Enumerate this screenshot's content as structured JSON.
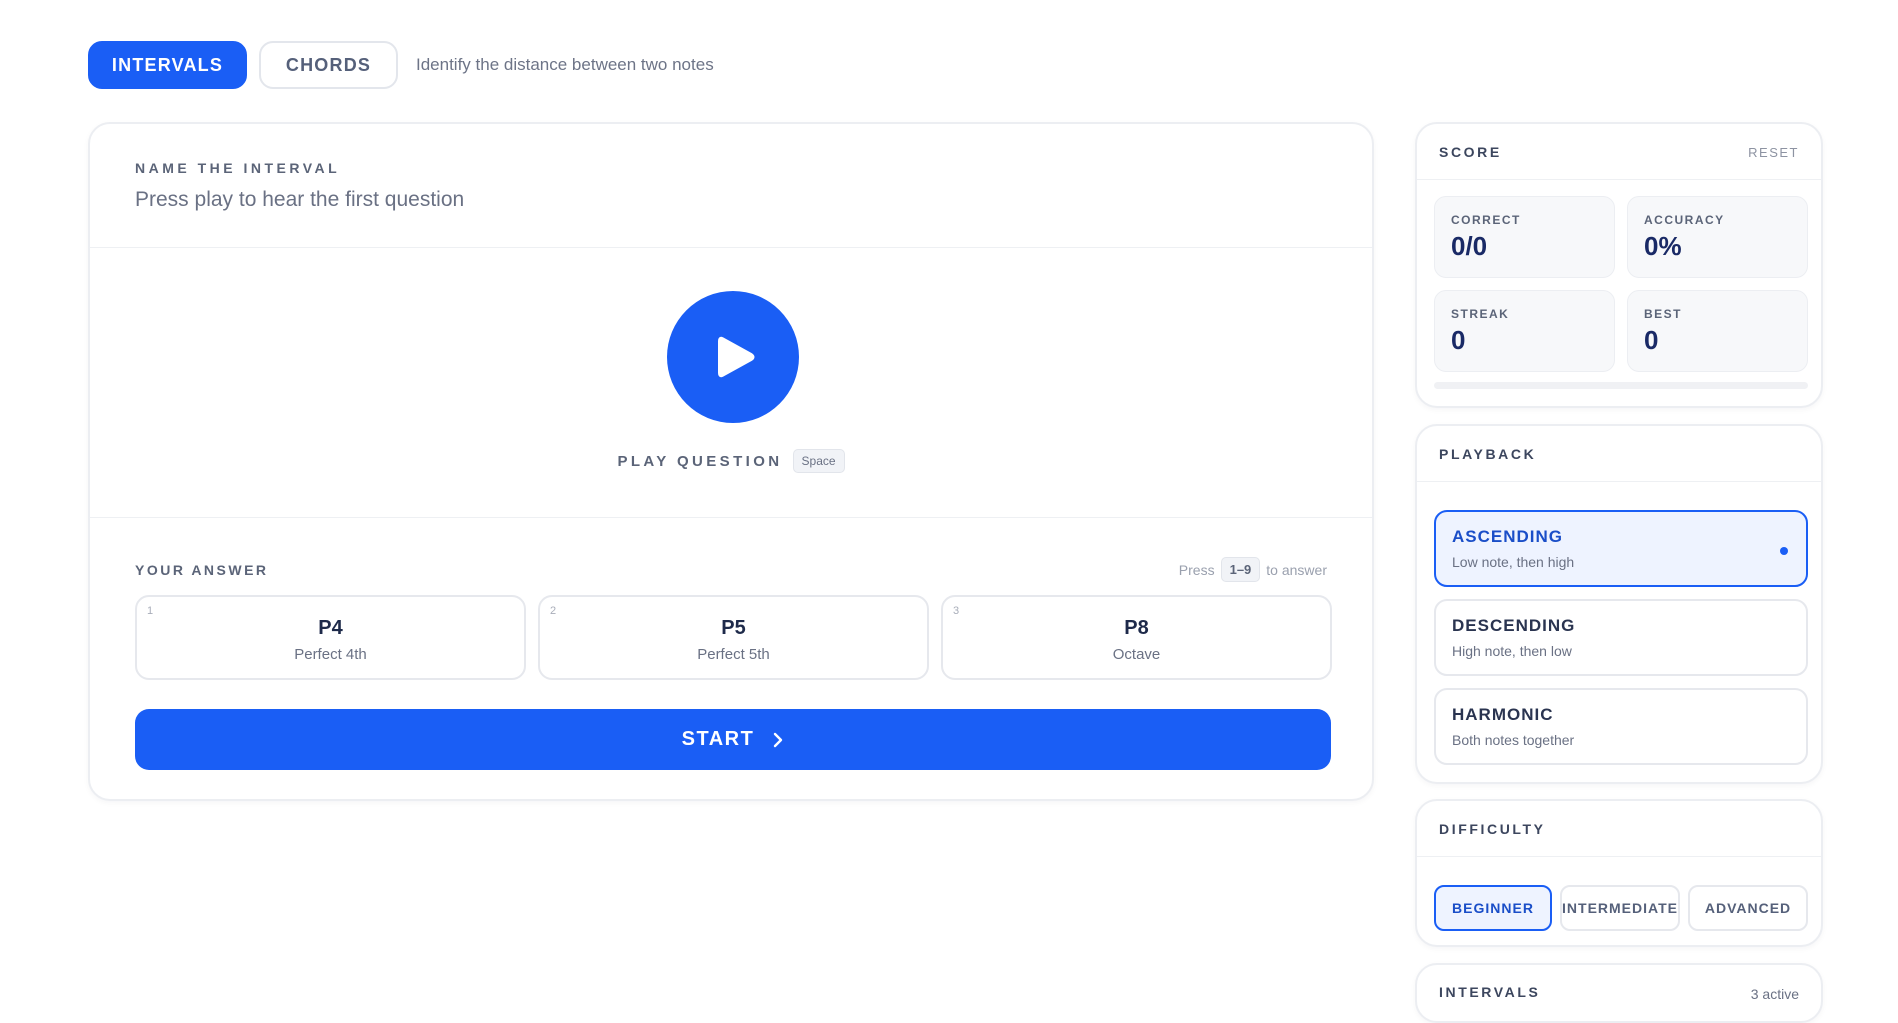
{
  "mode_tabs": {
    "intervals_label": "INTERVALS",
    "chords_label": "CHORDS",
    "description": "Identify the distance between two notes"
  },
  "question": {
    "label": "NAME THE INTERVAL",
    "prompt": "Press play to hear the first question"
  },
  "play": {
    "caption": "PLAY QUESTION",
    "shortcut": "Space",
    "icon": "play-icon"
  },
  "answer": {
    "label": "YOUR ANSWER",
    "hint_prefix": "Press",
    "hint_keys": "1–9",
    "hint_suffix": "to answer",
    "options": [
      {
        "num": "1",
        "abbr": "P4",
        "name": "Perfect 4th"
      },
      {
        "num": "2",
        "abbr": "P5",
        "name": "Perfect 5th"
      },
      {
        "num": "3",
        "abbr": "P8",
        "name": "Octave"
      }
    ]
  },
  "start_button": {
    "label": "START",
    "icon": "chevron-right-icon"
  },
  "score": {
    "title": "SCORE",
    "reset_label": "RESET",
    "correct_label": "CORRECT",
    "correct_value": "0/0",
    "accuracy_label": "ACCURACY",
    "accuracy_value": "0%",
    "streak_label": "STREAK",
    "streak_value": "0",
    "best_label": "BEST",
    "best_value": "0",
    "progress_fraction": 0
  },
  "playback": {
    "title": "PLAYBACK",
    "options": [
      {
        "name": "ASCENDING",
        "desc": "Low note, then high",
        "selected": true
      },
      {
        "name": "DESCENDING",
        "desc": "High note, then low",
        "selected": false
      },
      {
        "name": "HARMONIC",
        "desc": "Both notes together",
        "selected": false
      }
    ]
  },
  "difficulty": {
    "title": "DIFFICULTY",
    "options": [
      {
        "label": "BEGINNER",
        "selected": true
      },
      {
        "label": "INTERMEDIATE",
        "selected": false
      },
      {
        "label": "ADVANCED",
        "selected": false
      }
    ]
  },
  "intervals_panel": {
    "title": "INTERVALS",
    "count": "3 active"
  },
  "colors": {
    "accent": "#1a5ef5",
    "selected_bg": "#eef3ff",
    "text_dark": "#1e2a4a",
    "text_muted": "#6a7184"
  }
}
